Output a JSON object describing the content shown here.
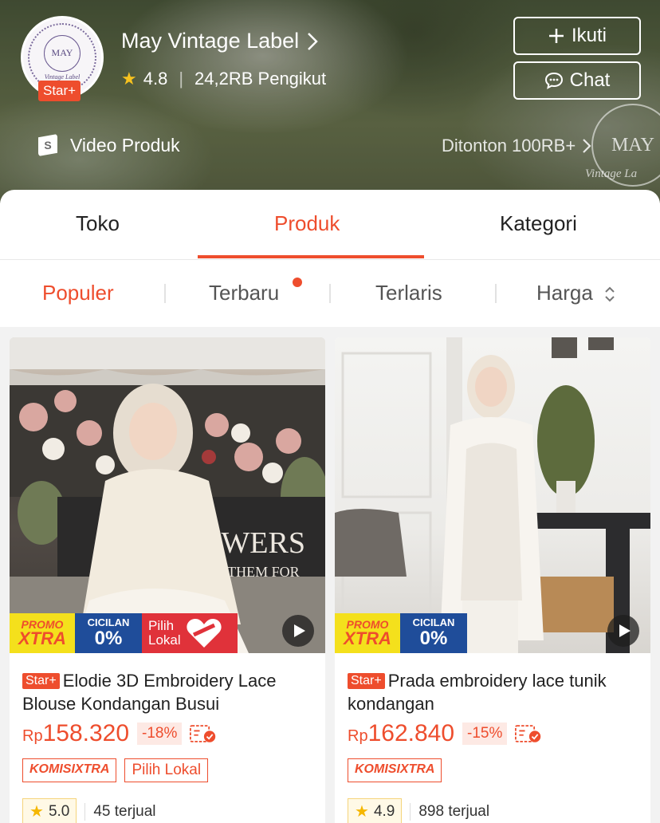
{
  "colors": {
    "accent": "#ee4d2d",
    "star": "#f7c21f",
    "cicilan": "#1f4d9a",
    "promo_yellow": "#f4e01c"
  },
  "shop": {
    "name": "May Vintage Label",
    "badge": "Star+",
    "rating": "4.8",
    "followers": "24,2RB Pengikut",
    "follow_label": "Ikuti",
    "chat_label": "Chat",
    "avatar_text": "MAY",
    "avatar_sub": "Vintage Label",
    "video_label": "Video Produk",
    "views_label": "Ditonton 100RB+",
    "watermark_text": "MAY",
    "watermark_sub": "Vintage La"
  },
  "tabs": [
    {
      "label": "Toko"
    },
    {
      "label": "Produk"
    },
    {
      "label": "Kategori"
    }
  ],
  "sort": [
    {
      "label": "Populer"
    },
    {
      "label": "Terbaru"
    },
    {
      "label": "Terlaris"
    },
    {
      "label": "Harga"
    }
  ],
  "products": [
    {
      "title": "Elodie 3D Embroidery Lace Blouse Kondangan Busui",
      "badge": "Star+",
      "currency": "Rp",
      "price": "158.320",
      "discount": "-18%",
      "promo_top": "PROMO",
      "promo_bottom": "XTRA",
      "cicilan_top": "CICILAN",
      "cicilan_bottom": "0%",
      "lokal_top": "Pilih",
      "lokal_bottom": "Lokal",
      "tag_komisi": "KOMISIXTRA",
      "tag_lokal": "Pilih Lokal",
      "rating": "5.0",
      "sold": "45 terjual",
      "photo_text": "OWERS",
      "photo_text2": "ICK THEM FOR"
    },
    {
      "title": "Prada embroidery lace tunik kondangan",
      "badge": "Star+",
      "currency": "Rp",
      "price": "162.840",
      "discount": "-15%",
      "promo_top": "PROMO",
      "promo_bottom": "XTRA",
      "cicilan_top": "CICILAN",
      "cicilan_bottom": "0%",
      "tag_komisi": "KOMISIXTRA",
      "rating": "4.9",
      "sold": "898 terjual"
    }
  ]
}
